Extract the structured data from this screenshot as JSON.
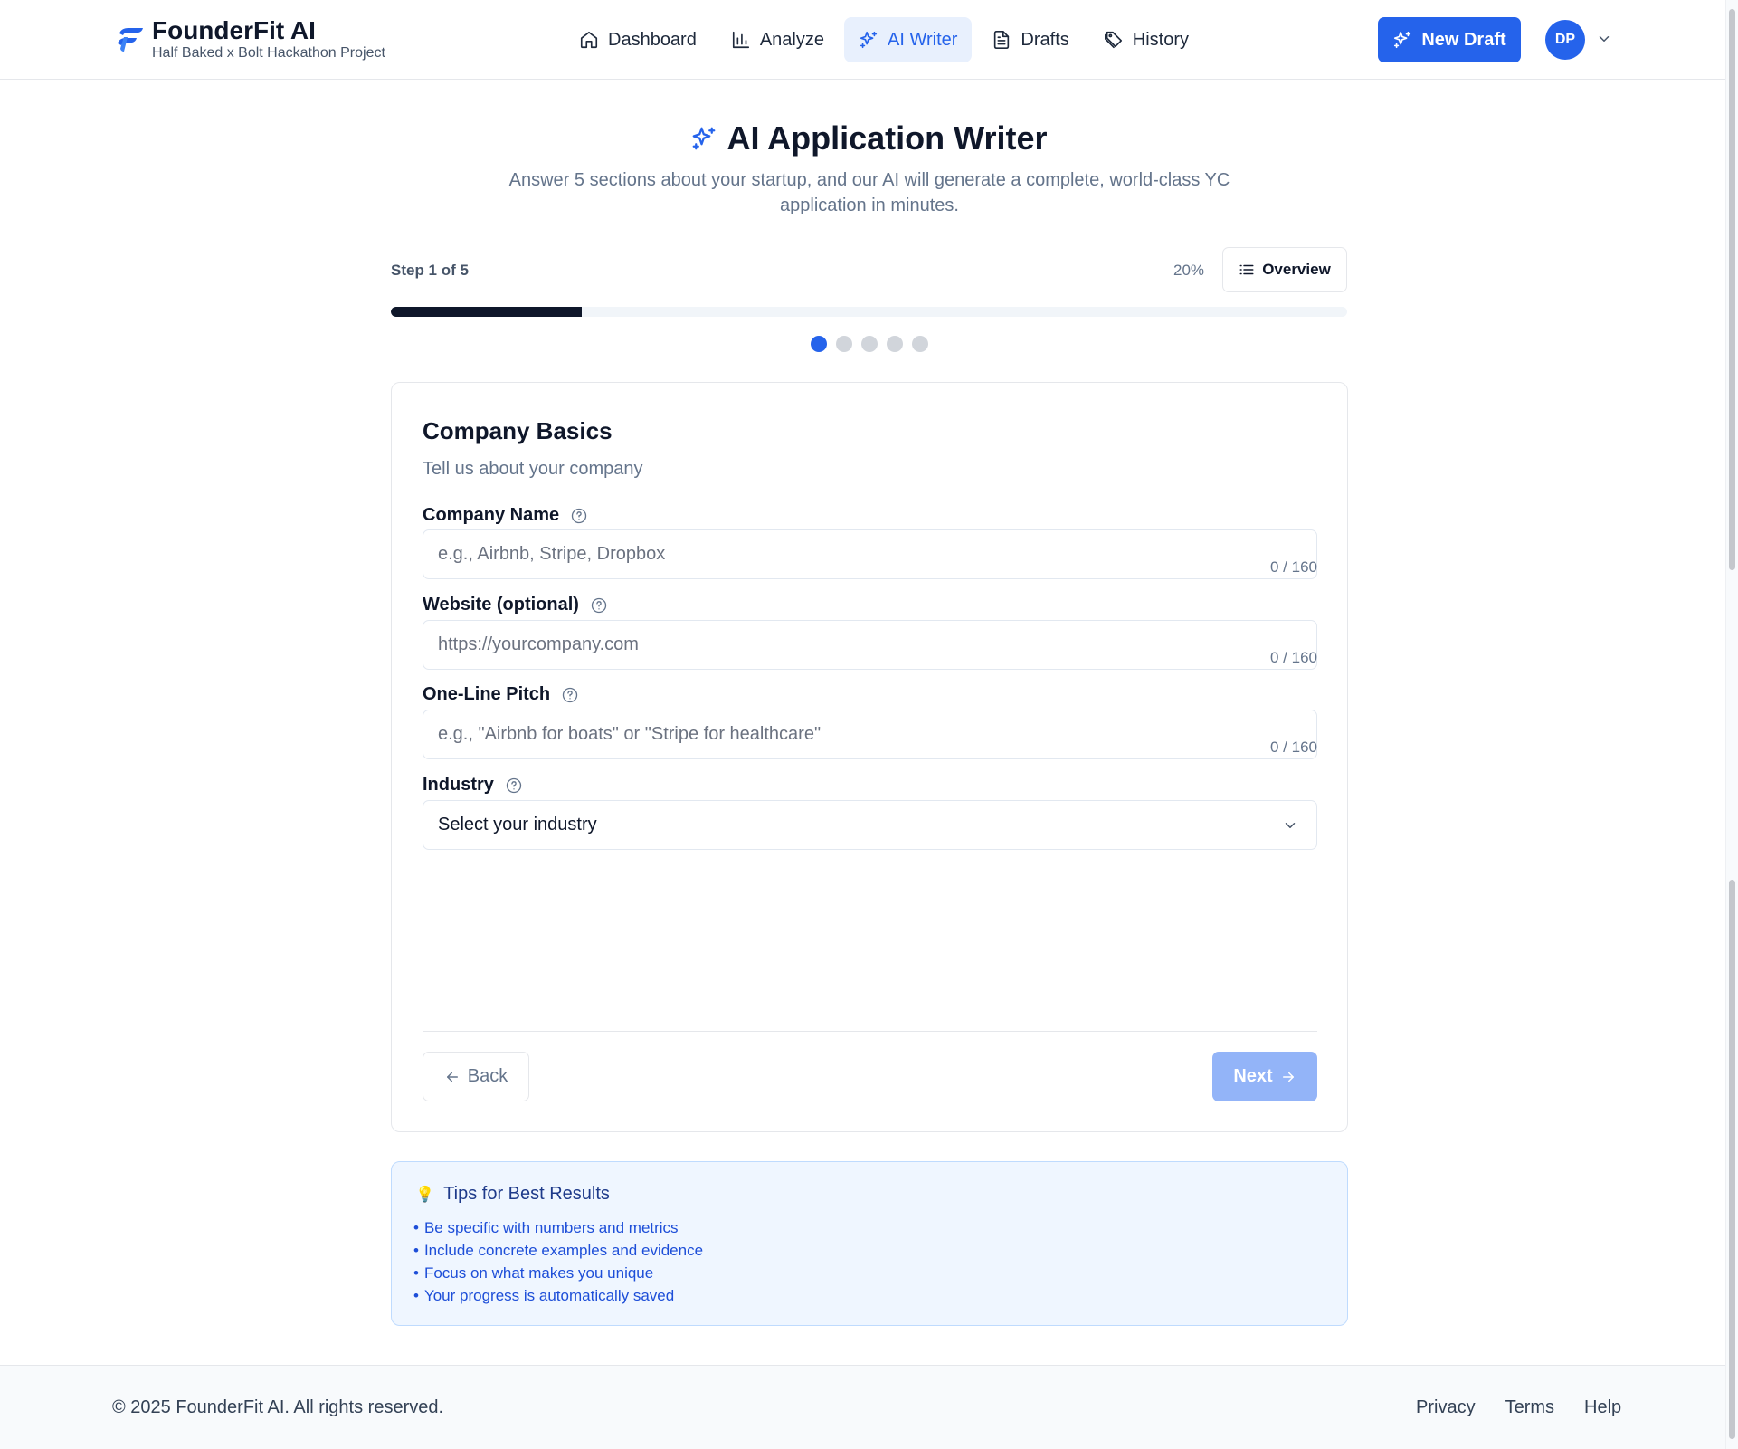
{
  "brand": {
    "name": "FounderFit AI",
    "subtitle": "Half Baked x Bolt Hackathon Project",
    "logo_icon": "founderfit-logo-icon",
    "accent_color": "#2563eb"
  },
  "nav": {
    "items": [
      {
        "label": "Dashboard",
        "icon": "home-icon",
        "active": false
      },
      {
        "label": "Analyze",
        "icon": "bar-chart-icon",
        "active": false
      },
      {
        "label": "AI Writer",
        "icon": "sparkles-icon",
        "active": true
      },
      {
        "label": "Drafts",
        "icon": "file-text-icon",
        "active": false
      },
      {
        "label": "History",
        "icon": "tag-icon",
        "active": false
      }
    ],
    "new_draft_label": "New Draft",
    "avatar_initials": "DP"
  },
  "hero": {
    "title": "AI Application Writer",
    "subtitle": "Answer 5 sections about your startup, and our AI will generate a complete, world-class YC application in minutes."
  },
  "progress": {
    "step_label": "Step 1 of 5",
    "percent_label": "20%",
    "fraction": 0.2,
    "overview_label": "Overview",
    "total_steps": 5,
    "current_step": 1
  },
  "form": {
    "title": "Company Basics",
    "description": "Tell us about your company",
    "fields": [
      {
        "label": "Company Name",
        "placeholder": "e.g., Airbnb, Stripe, Dropbox",
        "value": "",
        "counter": "0 / 160"
      },
      {
        "label": "Website (optional)",
        "placeholder": "https://yourcompany.com",
        "value": "",
        "counter": "0 / 160"
      },
      {
        "label": "One-Line Pitch",
        "placeholder": "e.g., \"Airbnb for boats\" or \"Stripe for healthcare\"",
        "value": "",
        "counter": "0 / 160"
      }
    ],
    "industry": {
      "label": "Industry",
      "selected": "Select your industry"
    },
    "back_label": "Back",
    "next_label": "Next"
  },
  "tips": {
    "title": "Tips for Best Results",
    "items": [
      "Be specific with numbers and metrics",
      "Include concrete examples and evidence",
      "Focus on what makes you unique",
      "Your progress is automatically saved"
    ]
  },
  "footer": {
    "copyright": "© 2025 FounderFit AI. All rights reserved.",
    "links": [
      "Privacy",
      "Terms",
      "Help"
    ]
  }
}
